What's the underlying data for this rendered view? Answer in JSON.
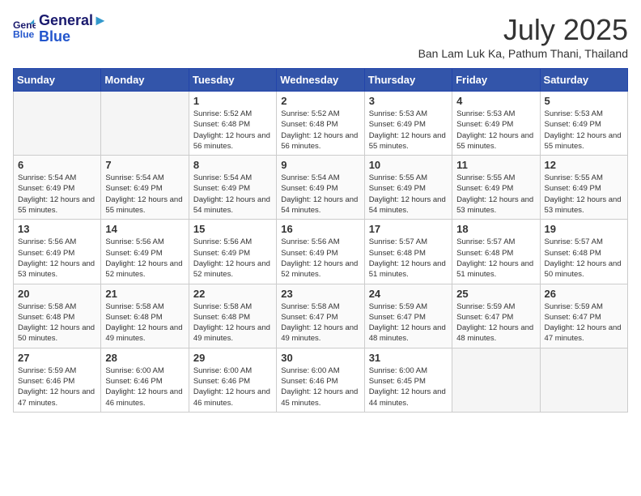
{
  "header": {
    "logo_line1": "General",
    "logo_line2": "Blue",
    "month": "July 2025",
    "location": "Ban Lam Luk Ka, Pathum Thani, Thailand"
  },
  "days_of_week": [
    "Sunday",
    "Monday",
    "Tuesday",
    "Wednesday",
    "Thursday",
    "Friday",
    "Saturday"
  ],
  "weeks": [
    [
      {
        "day": "",
        "empty": true
      },
      {
        "day": "",
        "empty": true
      },
      {
        "day": "1",
        "sunrise": "5:52 AM",
        "sunset": "6:48 PM",
        "daylight": "12 hours and 56 minutes."
      },
      {
        "day": "2",
        "sunrise": "5:52 AM",
        "sunset": "6:48 PM",
        "daylight": "12 hours and 56 minutes."
      },
      {
        "day": "3",
        "sunrise": "5:53 AM",
        "sunset": "6:49 PM",
        "daylight": "12 hours and 55 minutes."
      },
      {
        "day": "4",
        "sunrise": "5:53 AM",
        "sunset": "6:49 PM",
        "daylight": "12 hours and 55 minutes."
      },
      {
        "day": "5",
        "sunrise": "5:53 AM",
        "sunset": "6:49 PM",
        "daylight": "12 hours and 55 minutes."
      }
    ],
    [
      {
        "day": "6",
        "sunrise": "5:54 AM",
        "sunset": "6:49 PM",
        "daylight": "12 hours and 55 minutes."
      },
      {
        "day": "7",
        "sunrise": "5:54 AM",
        "sunset": "6:49 PM",
        "daylight": "12 hours and 55 minutes."
      },
      {
        "day": "8",
        "sunrise": "5:54 AM",
        "sunset": "6:49 PM",
        "daylight": "12 hours and 54 minutes."
      },
      {
        "day": "9",
        "sunrise": "5:54 AM",
        "sunset": "6:49 PM",
        "daylight": "12 hours and 54 minutes."
      },
      {
        "day": "10",
        "sunrise": "5:55 AM",
        "sunset": "6:49 PM",
        "daylight": "12 hours and 54 minutes."
      },
      {
        "day": "11",
        "sunrise": "5:55 AM",
        "sunset": "6:49 PM",
        "daylight": "12 hours and 53 minutes."
      },
      {
        "day": "12",
        "sunrise": "5:55 AM",
        "sunset": "6:49 PM",
        "daylight": "12 hours and 53 minutes."
      }
    ],
    [
      {
        "day": "13",
        "sunrise": "5:56 AM",
        "sunset": "6:49 PM",
        "daylight": "12 hours and 53 minutes."
      },
      {
        "day": "14",
        "sunrise": "5:56 AM",
        "sunset": "6:49 PM",
        "daylight": "12 hours and 52 minutes."
      },
      {
        "day": "15",
        "sunrise": "5:56 AM",
        "sunset": "6:49 PM",
        "daylight": "12 hours and 52 minutes."
      },
      {
        "day": "16",
        "sunrise": "5:56 AM",
        "sunset": "6:49 PM",
        "daylight": "12 hours and 52 minutes."
      },
      {
        "day": "17",
        "sunrise": "5:57 AM",
        "sunset": "6:48 PM",
        "daylight": "12 hours and 51 minutes."
      },
      {
        "day": "18",
        "sunrise": "5:57 AM",
        "sunset": "6:48 PM",
        "daylight": "12 hours and 51 minutes."
      },
      {
        "day": "19",
        "sunrise": "5:57 AM",
        "sunset": "6:48 PM",
        "daylight": "12 hours and 50 minutes."
      }
    ],
    [
      {
        "day": "20",
        "sunrise": "5:58 AM",
        "sunset": "6:48 PM",
        "daylight": "12 hours and 50 minutes."
      },
      {
        "day": "21",
        "sunrise": "5:58 AM",
        "sunset": "6:48 PM",
        "daylight": "12 hours and 49 minutes."
      },
      {
        "day": "22",
        "sunrise": "5:58 AM",
        "sunset": "6:48 PM",
        "daylight": "12 hours and 49 minutes."
      },
      {
        "day": "23",
        "sunrise": "5:58 AM",
        "sunset": "6:47 PM",
        "daylight": "12 hours and 49 minutes."
      },
      {
        "day": "24",
        "sunrise": "5:59 AM",
        "sunset": "6:47 PM",
        "daylight": "12 hours and 48 minutes."
      },
      {
        "day": "25",
        "sunrise": "5:59 AM",
        "sunset": "6:47 PM",
        "daylight": "12 hours and 48 minutes."
      },
      {
        "day": "26",
        "sunrise": "5:59 AM",
        "sunset": "6:47 PM",
        "daylight": "12 hours and 47 minutes."
      }
    ],
    [
      {
        "day": "27",
        "sunrise": "5:59 AM",
        "sunset": "6:46 PM",
        "daylight": "12 hours and 47 minutes."
      },
      {
        "day": "28",
        "sunrise": "6:00 AM",
        "sunset": "6:46 PM",
        "daylight": "12 hours and 46 minutes."
      },
      {
        "day": "29",
        "sunrise": "6:00 AM",
        "sunset": "6:46 PM",
        "daylight": "12 hours and 46 minutes."
      },
      {
        "day": "30",
        "sunrise": "6:00 AM",
        "sunset": "6:46 PM",
        "daylight": "12 hours and 45 minutes."
      },
      {
        "day": "31",
        "sunrise": "6:00 AM",
        "sunset": "6:45 PM",
        "daylight": "12 hours and 44 minutes."
      },
      {
        "day": "",
        "empty": true
      },
      {
        "day": "",
        "empty": true
      }
    ]
  ]
}
